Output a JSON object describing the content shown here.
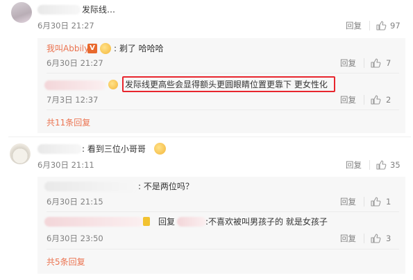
{
  "comments": [
    {
      "text": "发际线…",
      "time": "6月30日 21:27",
      "reply_label": "回复",
      "likes": "97",
      "replies": [
        {
          "author": "我叫Abbily",
          "text": ": 剃了 哈哈哈",
          "time": "6月30日 21:27",
          "reply_label": "回复",
          "likes": "7"
        },
        {
          "text": "发际线更高些会显得额头更圆眼睛位置更靠下 更女性化",
          "time": "7月3日 12:37",
          "reply_label": "回复",
          "likes": "2"
        }
      ],
      "more_label": "共11条回复"
    },
    {
      "text": ": 看到三位小哥哥",
      "time": "6月30日 21:11",
      "reply_label": "回复",
      "likes": "35",
      "replies": [
        {
          "text": ": 不是两位吗？",
          "time": "6月30日 21:15",
          "reply_label": "回复",
          "likes": "1"
        },
        {
          "prefix": "回复",
          "text": ":不喜欢被叫男孩子的 就是女孩子",
          "time": "6月30日 23:50",
          "reply_label": "回复",
          "likes": "3"
        }
      ],
      "more_label": "共5条回复"
    }
  ],
  "colors": {
    "link": "#eb7350",
    "highlight": "#e8252d",
    "muted": "#808080"
  },
  "icons": {
    "like": "thumbs-up-icon",
    "verified": "verified-v-icon",
    "badge": "fan-badge-icon"
  }
}
